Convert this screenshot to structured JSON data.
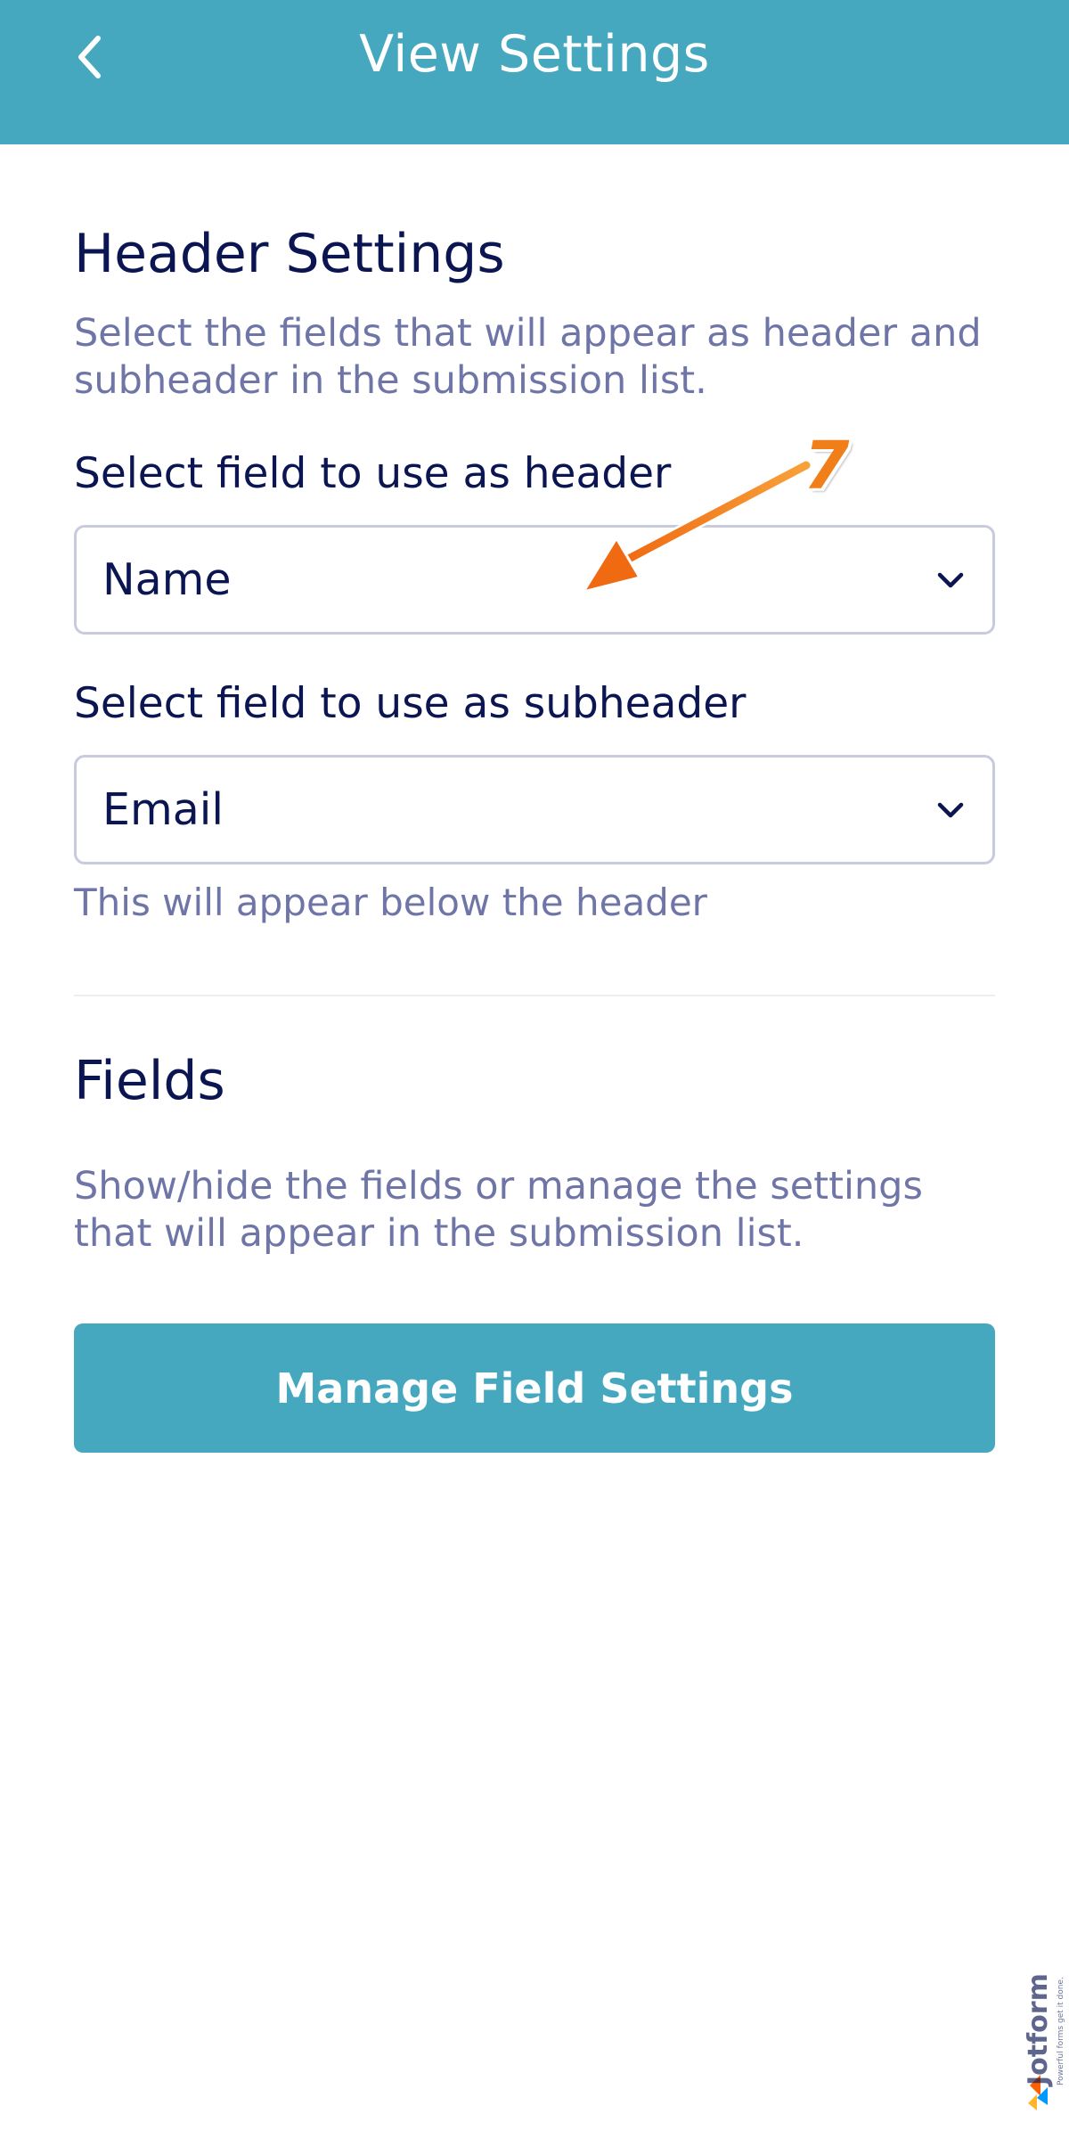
{
  "topbar": {
    "title": "View Settings",
    "back_icon": "chevron-left-icon",
    "background_color": "#46a8be"
  },
  "header_settings": {
    "title": "Header Settings",
    "description": "Select the fields that will appear as header and subheader in the submission list.",
    "header_field": {
      "label": "Select field to use as header",
      "selected_value": "Name"
    },
    "subheader_field": {
      "label": "Select field to use as subheader",
      "selected_value": "Email",
      "helper_text": "This will appear below the header"
    }
  },
  "fields_section": {
    "title": "Fields",
    "description": "Show/hide the fields or manage the settings that will appear in the submission list.",
    "manage_button_label": "Manage Field Settings"
  },
  "annotation": {
    "step_number": "7",
    "arrow_color": "#f07f1a"
  },
  "watermark": {
    "brand": "Jotform",
    "tagline": "Powerful forms get it done."
  },
  "colors": {
    "accent": "#46a8be",
    "text_primary": "#0a1551",
    "text_secondary": "#6f76a7",
    "border": "#c8cbdc"
  }
}
